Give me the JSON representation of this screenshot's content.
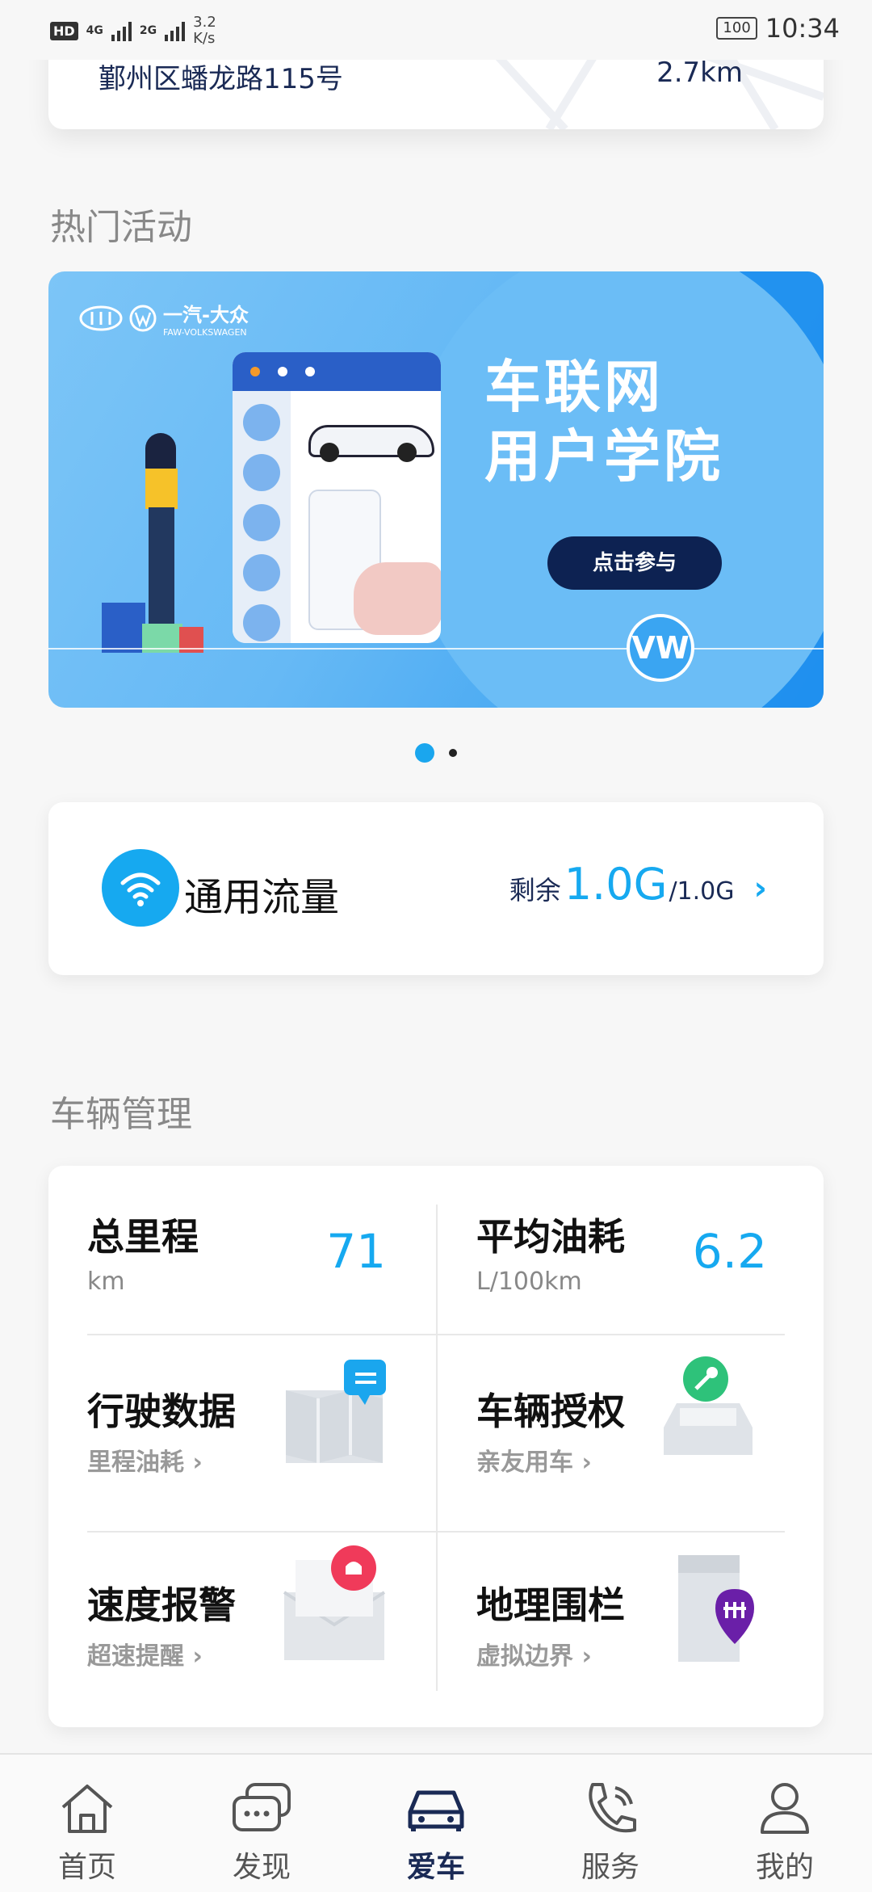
{
  "status_bar": {
    "hd": "HD",
    "net1": "4G",
    "net2": "2G",
    "speed_value": "3.2",
    "speed_unit": "K/s",
    "battery": "100",
    "time": "10:34"
  },
  "top_card": {
    "address": "鄞州区蟠龙路115号",
    "distance": "2.7km"
  },
  "hot_activities": {
    "title": "热门活动",
    "banner": {
      "brand_cn": "一汽-大众",
      "brand_en": "FAW-VOLKSWAGEN",
      "headline_line1": "车联网",
      "headline_line2": "用户学院",
      "cta": "点击参与",
      "vw_mark": "VW"
    },
    "page_count": 2,
    "active_page": 1
  },
  "data_plan": {
    "label": "通用流量",
    "remain_label": "剩余",
    "remain_value": "1.0G",
    "total": "/1.0G",
    "chevron": "›"
  },
  "vehicle": {
    "title": "车辆管理",
    "total_mileage": {
      "label": "总里程",
      "unit": "km",
      "value": "71"
    },
    "avg_fuel": {
      "label": "平均油耗",
      "unit": "L/100km",
      "value": "6.2"
    },
    "drive_data": {
      "label": "行驶数据",
      "sub": "里程油耗 ›"
    },
    "authorization": {
      "label": "车辆授权",
      "sub": "亲友用车 ›"
    },
    "speed_alarm": {
      "label": "速度报警",
      "sub": "超速提醒 ›"
    },
    "geofence": {
      "label": "地理围栏",
      "sub": "虚拟边界 ›"
    }
  },
  "bottom_nav": {
    "items": [
      {
        "label": "首页",
        "icon": "home-icon"
      },
      {
        "label": "发现",
        "icon": "chat-icon"
      },
      {
        "label": "爱车",
        "icon": "car-icon",
        "active": true
      },
      {
        "label": "服务",
        "icon": "phone-icon"
      },
      {
        "label": "我的",
        "icon": "person-icon"
      }
    ]
  },
  "colors": {
    "accent": "#16a9f0",
    "navy": "#1a2a55",
    "banner_blue": "#66b9f5"
  }
}
